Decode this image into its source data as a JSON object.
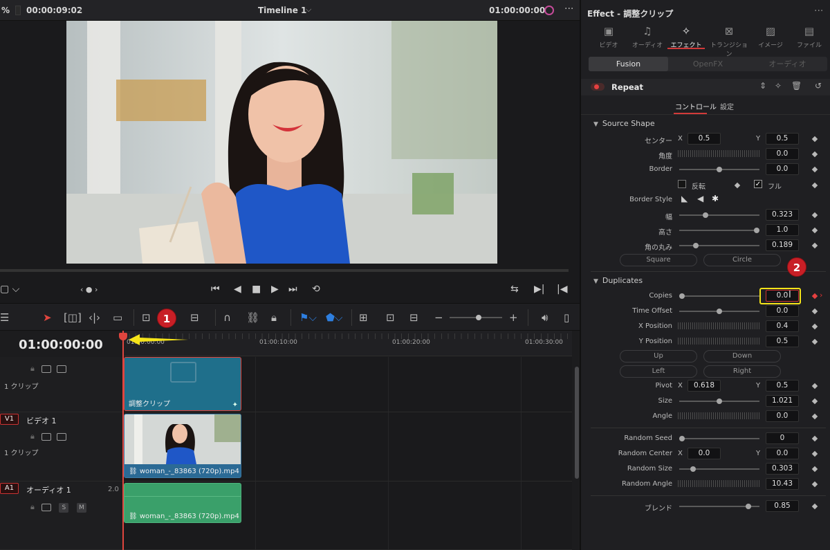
{
  "viewer": {
    "zoom": "%",
    "duration": "00:00:09:02",
    "timeline_name": "Timeline 1",
    "timecode": "01:00:00:00"
  },
  "timeline": {
    "timecode": "01:00:00:00",
    "ruler": [
      "01:00:00:00",
      "01:00:10:00",
      "01:00:20:00",
      "01:00:30:00"
    ],
    "tracks": [
      {
        "tag": "",
        "name": "",
        "count": "1 クリップ",
        "clip": "調整クリップ"
      },
      {
        "tag": "V1",
        "name": "ビデオ 1",
        "count": "1 クリップ",
        "clip": "woman_-_83863 (720p).mp4"
      },
      {
        "tag": "A1",
        "name": "オーディオ 1",
        "level": "2.0",
        "clip": "woman_-_83863 (720p).mp4"
      }
    ],
    "audio_buttons": [
      "S",
      "M"
    ]
  },
  "inspector": {
    "title": "Effect - 調整クリップ",
    "tabs": [
      "ビデオ",
      "オーディオ",
      "エフェクト",
      "トランジション",
      "イメージ",
      "ファイル"
    ],
    "segments": [
      "Fusion",
      "OpenFX",
      "オーディオ"
    ],
    "effect_name": "Repeat",
    "subtabs": [
      "コントロール",
      "設定"
    ],
    "source_shape": {
      "heading": "Source Shape",
      "center_label": "センター",
      "x_label": "X",
      "y_label": "Y",
      "center_x": "0.5",
      "center_y": "0.5",
      "angle_label": "角度",
      "angle": "0.0",
      "border_label": "Border",
      "border": "0.0",
      "invert_label": "反転",
      "full_label": "フル",
      "border_style_label": "Border Style",
      "width_label": "幅",
      "width": "0.323",
      "height_label": "高さ",
      "height": "1.0",
      "round_label": "角の丸み",
      "round": "0.189",
      "square_btn": "Square",
      "circle_btn": "Circle"
    },
    "duplicates": {
      "heading": "Duplicates",
      "copies_label": "Copies",
      "copies": "0.0",
      "time_offset_label": "Time Offset",
      "time_offset": "0.0",
      "x_pos_label": "X Position",
      "x_pos": "0.4",
      "y_pos_label": "Y Position",
      "y_pos": "0.5",
      "up_btn": "Up",
      "down_btn": "Down",
      "left_btn": "Left",
      "right_btn": "Right",
      "pivot_label": "Pivot",
      "pivot_x": "0.618",
      "pivot_y": "0.5",
      "size_label": "Size",
      "size": "1.021",
      "angle_label": "Angle",
      "angle": "0.0"
    },
    "random": {
      "seed_label": "Random Seed",
      "seed": "0",
      "center_label": "Random Center",
      "center_x": "0.0",
      "center_y": "0.0",
      "size_label": "Random Size",
      "size": "0.303",
      "angle_label": "Random Angle",
      "angle": "10.43"
    },
    "blend_label": "ブレンド",
    "blend": "0.85"
  },
  "annotations": {
    "badge1": "1",
    "badge2": "2"
  },
  "colors": {
    "accent": "#d23a3a",
    "adjust_clip": "#1f6f8b",
    "video_clip": "#2b6a95",
    "audio_clip": "#3aa06a",
    "highlight": "#f5e419"
  }
}
